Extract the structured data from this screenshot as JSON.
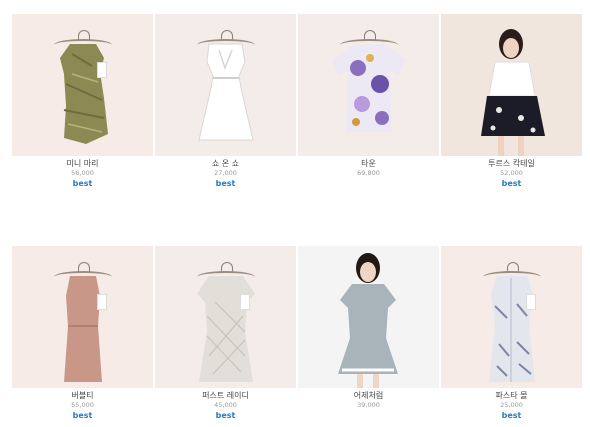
{
  "products": [
    {
      "name": "미니 마리",
      "price": "56,000",
      "badge": "best",
      "icon": "dress-olive-print",
      "color": "#8c8a52"
    },
    {
      "name": "쇼 온 쇼",
      "price": "27,000",
      "badge": "best",
      "icon": "dress-white",
      "color": "#f2f2f2"
    },
    {
      "name": "타운",
      "price": "69,800",
      "badge": "",
      "icon": "top-floral-purple",
      "color": "#8a6fc0"
    },
    {
      "name": "투르스 칵테일",
      "price": "52,000",
      "badge": "best",
      "icon": "model-white-top-floral-skirt",
      "color": "#1c1c28"
    },
    {
      "name": "버블티",
      "price": "55,000",
      "badge": "best",
      "icon": "dress-dusty-pink",
      "color": "#c99787"
    },
    {
      "name": "퍼스트 레이디",
      "price": "45,000",
      "badge": "best",
      "icon": "dress-lace-grey",
      "color": "#d6d2cc"
    },
    {
      "name": "어제처럼",
      "price": "39,000",
      "badge": "",
      "icon": "model-grey-dress",
      "color": "#a9b3ba"
    },
    {
      "name": "파스타 몰",
      "price": "25,000",
      "badge": "best",
      "icon": "shirt-dress-print",
      "color": "#9aa3b3"
    }
  ]
}
